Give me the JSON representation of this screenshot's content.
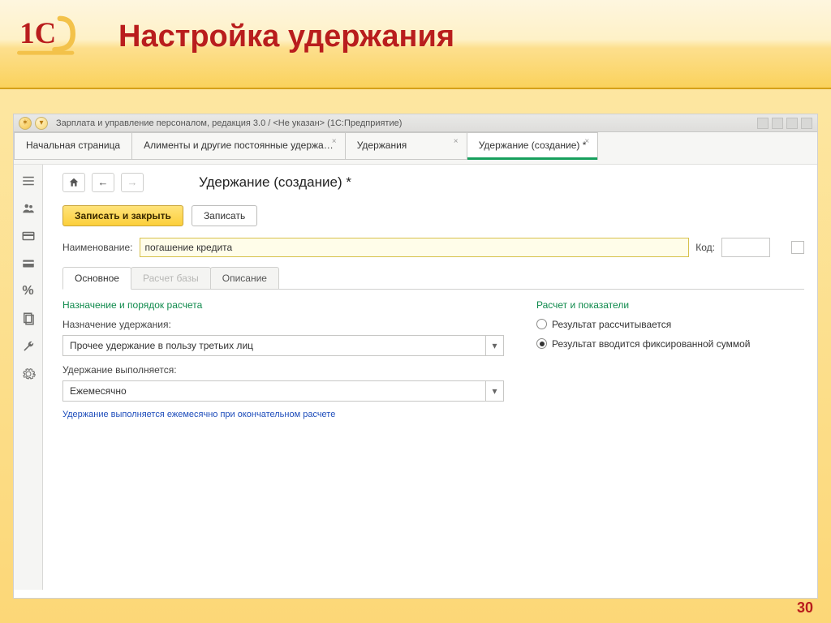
{
  "slide": {
    "title": "Настройка удержания",
    "page_number": "30"
  },
  "titlebar": {
    "text": "Зарплата и управление персоналом, редакция 3.0 / <Не указан>  (1С:Предприятие)"
  },
  "tabs": [
    {
      "label": "Начальная страница",
      "closable": false
    },
    {
      "label": "Алименты и другие постоянные удержа…",
      "closable": true
    },
    {
      "label": "Удержания",
      "closable": true
    },
    {
      "label": "Удержание (создание) *",
      "closable": true,
      "active": true
    }
  ],
  "content": {
    "page_title": "Удержание (создание) *",
    "actions": {
      "primary": "Записать и закрыть",
      "secondary": "Записать"
    },
    "name_row": {
      "label": "Наименование:",
      "value": "погашение кредита",
      "code_label": "Код:",
      "code_value": ""
    },
    "inner_tabs": [
      {
        "label": "Основное",
        "active": true
      },
      {
        "label": "Расчет базы",
        "muted": true
      },
      {
        "label": "Описание"
      }
    ],
    "left": {
      "section_heading": "Назначение и порядок расчета",
      "purpose_label": "Назначение удержания:",
      "purpose_value": "Прочее удержание в пользу третьих лиц",
      "period_label": "Удержание выполняется:",
      "period_value": "Ежемесячно",
      "hint": "Удержание выполняется ежемесячно при окончательном расчете"
    },
    "right": {
      "section_heading": "Расчет и показатели",
      "radio_calc": "Результат рассчитывается",
      "radio_fixed": "Результат вводится фиксированной суммой"
    }
  }
}
